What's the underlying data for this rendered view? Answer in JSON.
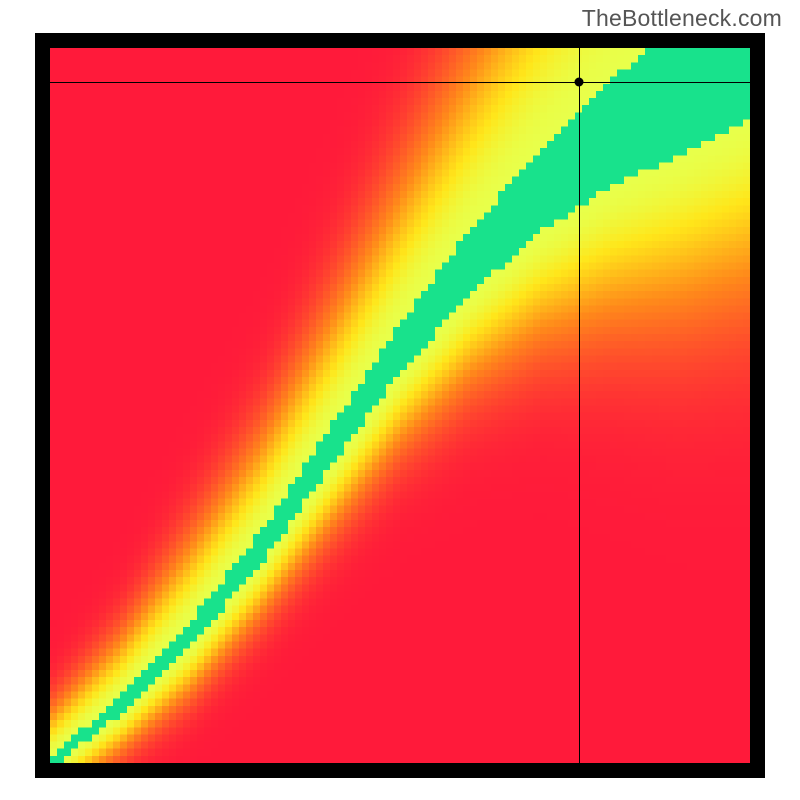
{
  "watermark": "TheBottleneck.com",
  "chart_data": {
    "type": "heatmap",
    "title": "",
    "xlabel": "",
    "ylabel": "",
    "xlim": [
      0,
      1
    ],
    "ylim": [
      0,
      1
    ],
    "grid_resolution": 100,
    "crosshair": {
      "x": 0.755,
      "y": 0.952
    },
    "marker": {
      "x": 0.755,
      "y": 0.952
    },
    "ridge_points": [
      {
        "x": 0.0,
        "y": 0.0
      },
      {
        "x": 0.1,
        "y": 0.08
      },
      {
        "x": 0.2,
        "y": 0.18
      },
      {
        "x": 0.3,
        "y": 0.3
      },
      {
        "x": 0.4,
        "y": 0.44
      },
      {
        "x": 0.5,
        "y": 0.58
      },
      {
        "x": 0.6,
        "y": 0.7
      },
      {
        "x": 0.7,
        "y": 0.8
      },
      {
        "x": 0.8,
        "y": 0.88
      },
      {
        "x": 0.9,
        "y": 0.94
      },
      {
        "x": 1.0,
        "y": 1.0
      }
    ],
    "band_half_width_points": [
      {
        "x": 0.0,
        "w": 0.008
      },
      {
        "x": 0.1,
        "w": 0.012
      },
      {
        "x": 0.2,
        "w": 0.018
      },
      {
        "x": 0.3,
        "w": 0.022
      },
      {
        "x": 0.4,
        "w": 0.028
      },
      {
        "x": 0.5,
        "w": 0.035
      },
      {
        "x": 0.6,
        "w": 0.045
      },
      {
        "x": 0.7,
        "w": 0.058
      },
      {
        "x": 0.8,
        "w": 0.075
      },
      {
        "x": 0.9,
        "w": 0.09
      },
      {
        "x": 1.0,
        "w": 0.1
      }
    ],
    "color_stops": [
      {
        "t": 0.0,
        "color": "#ff1a3a"
      },
      {
        "t": 0.4,
        "color": "#ff8a1a"
      },
      {
        "t": 0.68,
        "color": "#ffe61a"
      },
      {
        "t": 0.82,
        "color": "#e8ff4a"
      },
      {
        "t": 1.0,
        "color": "#18e28c"
      }
    ]
  }
}
